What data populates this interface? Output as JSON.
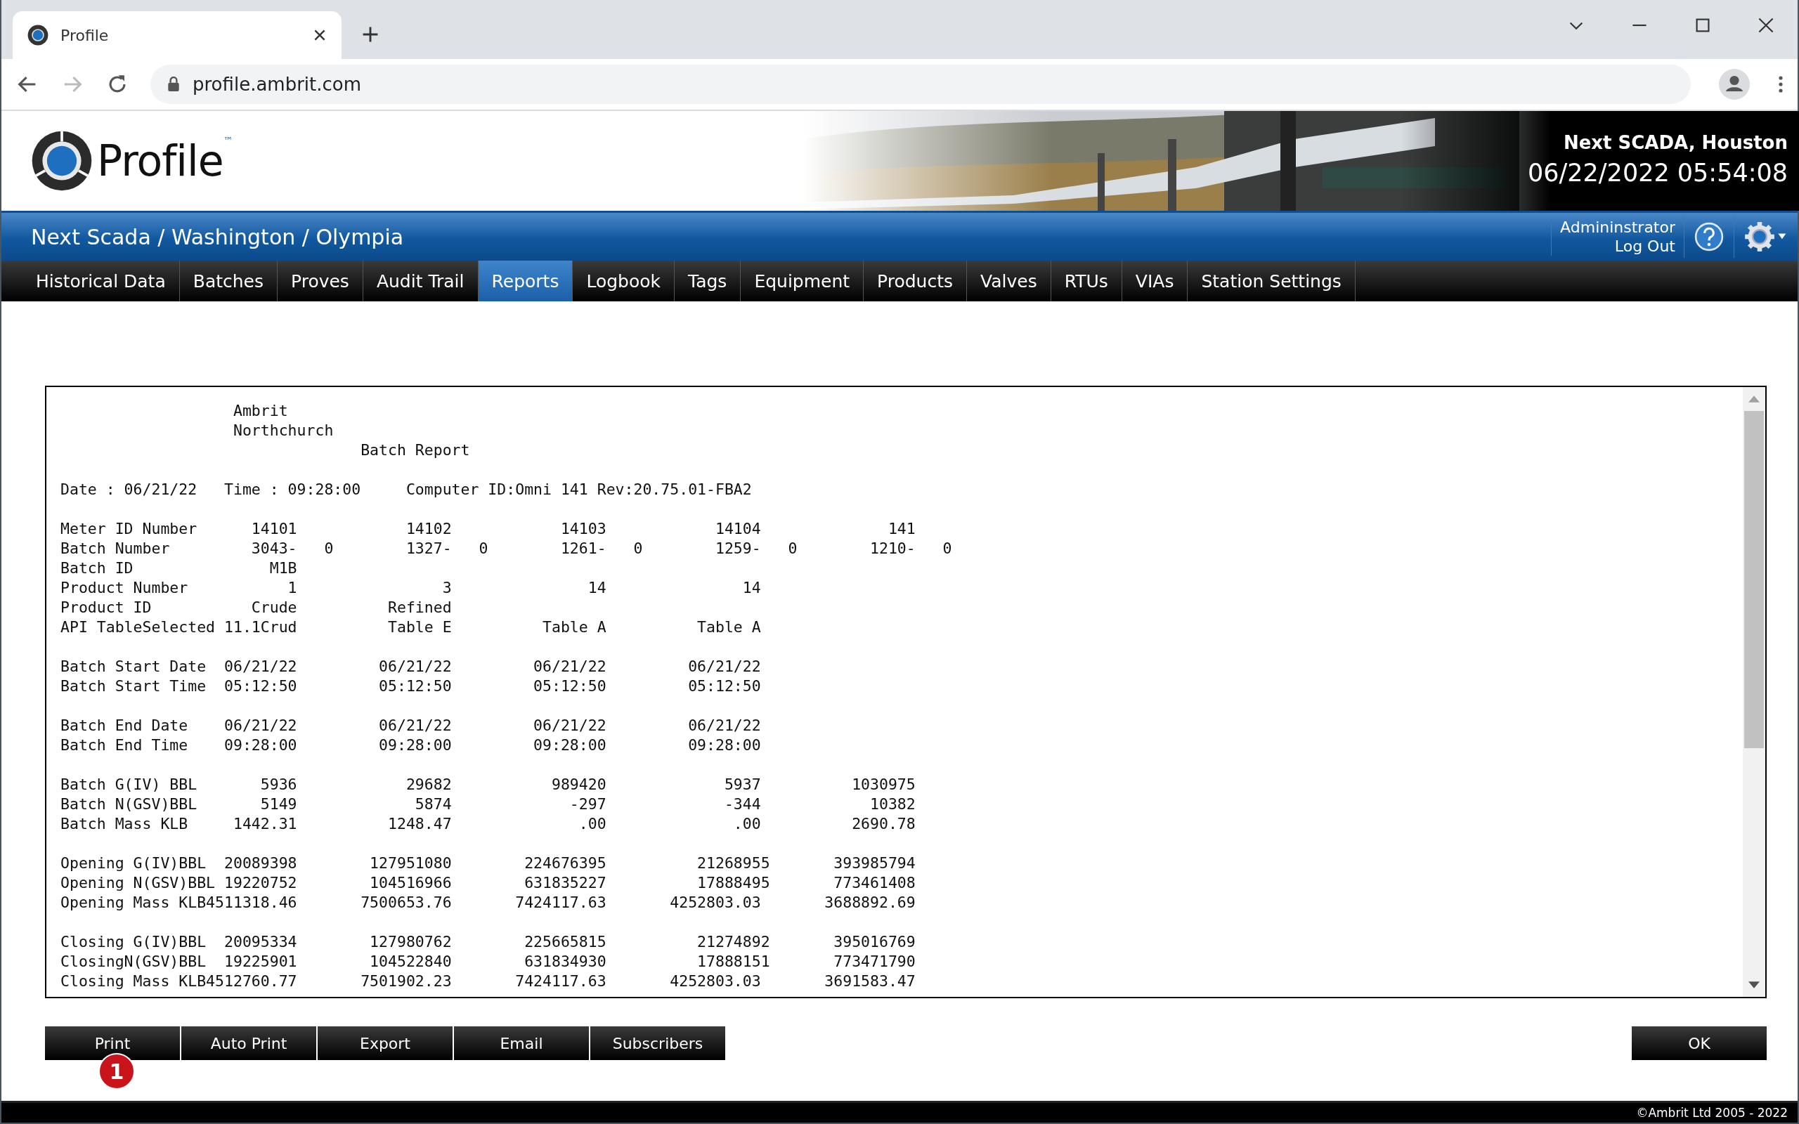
{
  "browser": {
    "tab_title": "Profile",
    "url": "profile.ambrit.com"
  },
  "header": {
    "logo": "Profile",
    "logo_mark": "™",
    "site": "Next SCADA, Houston",
    "datetime": "06/22/2022 05:54:08"
  },
  "breadcrumb": "Next Scada / Washington / Olympia",
  "user": {
    "name": "Admininstrator",
    "logout": "Log Out"
  },
  "nav": [
    {
      "label": "Historical Data",
      "selected": false
    },
    {
      "label": "Batches",
      "selected": false
    },
    {
      "label": "Proves",
      "selected": false
    },
    {
      "label": "Audit Trail",
      "selected": false
    },
    {
      "label": "Reports",
      "selected": true
    },
    {
      "label": "Logbook",
      "selected": false
    },
    {
      "label": "Tags",
      "selected": false
    },
    {
      "label": "Equipment",
      "selected": false
    },
    {
      "label": "Products",
      "selected": false
    },
    {
      "label": "Valves",
      "selected": false
    },
    {
      "label": "RTUs",
      "selected": false
    },
    {
      "label": "VIAs",
      "selected": false
    },
    {
      "label": "Station Settings",
      "selected": false
    }
  ],
  "report": {
    "blocks": [
      [
        "                   Ambrit",
        "                   Northchurch",
        "                                 Batch Report"
      ],
      [
        "Date : 06/21/22   Time : 09:28:00     Computer ID:Omni 141 Rev:20.75.01-FBA2"
      ],
      [
        "Meter ID Number      14101            14102            14103            14104              141",
        "Batch Number         3043-   0        1327-   0        1261-   0        1259-   0        1210-   0",
        "Batch ID               M1B",
        "Product Number           1                3               14               14",
        "Product ID           Crude          Refined",
        "API TableSelected 11.1Crud          Table E          Table A          Table A"
      ],
      [
        "Batch Start Date  06/21/22         06/21/22         06/21/22         06/21/22",
        "Batch Start Time  05:12:50         05:12:50         05:12:50         05:12:50"
      ],
      [
        "Batch End Date    06/21/22         06/21/22         06/21/22         06/21/22",
        "Batch End Time    09:28:00         09:28:00         09:28:00         09:28:00"
      ],
      [
        "Batch G(IV) BBL       5936            29682           989420             5937          1030975",
        "Batch N(GSV)BBL       5149             5874             -297             -344            10382",
        "Batch Mass KLB     1442.31          1248.47              .00              .00          2690.78"
      ],
      [
        "Opening G(IV)BBL  20089398        127951080        224676395          21268955       393985794",
        "Opening N(GSV)BBL 19220752        104516966        631835227          17888495       773461408",
        "Opening Mass KLB4511318.46       7500653.76       7424117.63       4252803.03       3688892.69"
      ],
      [
        "Closing G(IV)BBL  20095334        127980762        225665815          21274892       395016769",
        "ClosingN(GSV)BBL  19225901        104522840        631834930          17888151       773471790",
        "Closing Mass KLB4512760.77       7501902.23       7424117.63       4252803.03       3691583.47"
      ]
    ]
  },
  "actions": [
    "Print",
    "Auto Print",
    "Export",
    "Email",
    "Subscribers"
  ],
  "ok_button": "OK",
  "annotation_badge": "1",
  "footer": "©Ambrit Ltd 2005 - 2022"
}
